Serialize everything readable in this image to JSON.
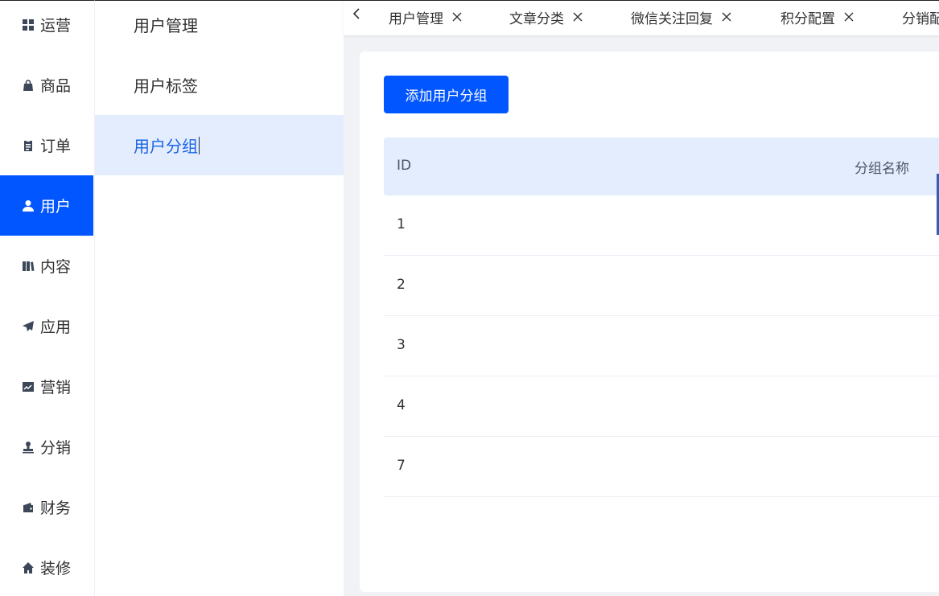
{
  "main_nav": [
    {
      "label": "运营",
      "icon": "grid-icon",
      "active": false
    },
    {
      "label": "商品",
      "icon": "shopping-bag-icon",
      "active": false
    },
    {
      "label": "订单",
      "icon": "clipboard-icon",
      "active": false
    },
    {
      "label": "用户",
      "icon": "user-icon",
      "active": true
    },
    {
      "label": "内容",
      "icon": "book-icon",
      "active": false
    },
    {
      "label": "应用",
      "icon": "paper-plane-icon",
      "active": false
    },
    {
      "label": "营销",
      "icon": "trend-chart-icon",
      "active": false
    },
    {
      "label": "分销",
      "icon": "stamp-icon",
      "active": false
    },
    {
      "label": "财务",
      "icon": "wallet-icon",
      "active": false
    },
    {
      "label": "装修",
      "icon": "home-icon",
      "active": false
    }
  ],
  "sub_nav": [
    {
      "label": "用户管理",
      "active": false
    },
    {
      "label": "用户标签",
      "active": false
    },
    {
      "label": "用户分组",
      "active": true
    }
  ],
  "tabs": [
    {
      "label": "用户管理"
    },
    {
      "label": "文章分类"
    },
    {
      "label": "微信关注回复"
    },
    {
      "label": "积分配置"
    },
    {
      "label": "分销配"
    }
  ],
  "content": {
    "add_button": "添加用户分组",
    "table": {
      "columns": [
        "ID",
        "分组名称"
      ],
      "rows": [
        {
          "id": "1",
          "name": ""
        },
        {
          "id": "2",
          "name": ""
        },
        {
          "id": "3",
          "name": ""
        },
        {
          "id": "4",
          "name": ""
        },
        {
          "id": "7",
          "name": ""
        }
      ]
    }
  },
  "colors": {
    "accent": "#0256ff",
    "active_sub_bg": "#e3edfe",
    "active_sub_text": "#1b63e6"
  }
}
